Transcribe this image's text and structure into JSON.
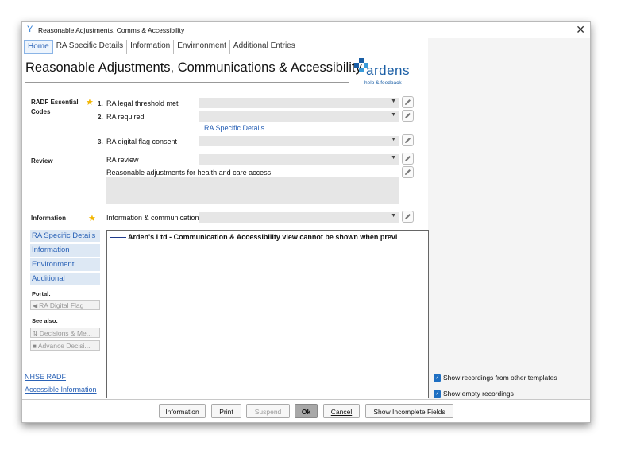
{
  "window": {
    "title": "Reasonable Adjustments, Comms & Accessibility",
    "close": "✕"
  },
  "tabs": [
    "Home",
    "RA Specific Details",
    "Information",
    "Envirnonment",
    "Additional Entries"
  ],
  "page_title": "Reasonable Adjustments, Communications & Accessibility",
  "logo": {
    "word": "ardens",
    "help": "help & feedback"
  },
  "sections": {
    "radf": {
      "label_line1": "RADF Essential",
      "label_line2": "Codes",
      "items": [
        {
          "num": "1.",
          "label": "RA legal threshold met"
        },
        {
          "num": "2.",
          "label": "RA required"
        },
        {
          "num": "3.",
          "label": "RA digital flag consent"
        }
      ],
      "link": "RA Specific Details"
    },
    "review": {
      "label": "Review",
      "field": "RA review",
      "text": "Reasonable adjustments for health and care access"
    },
    "information": {
      "label": "Information",
      "field": "Information & communication"
    }
  },
  "nav": [
    "RA Specific Details",
    "Information",
    "Environment",
    "Additional"
  ],
  "portal": {
    "label": "Portal:",
    "button": "RA Digital Flag"
  },
  "see_also": {
    "label": "See also:",
    "buttons": [
      "Decisions & Me...",
      "Advance Decisi..."
    ]
  },
  "viewer_message": "Arden's Ltd - Communication & Accessibility view cannot be shown when previ",
  "links": [
    "NHSE RADF",
    "Accessible Information"
  ],
  "options": {
    "show_other_templates": "Show recordings from other templates",
    "show_empty": "Show empty recordings"
  },
  "buttons": {
    "information": "Information",
    "print": "Print",
    "suspend": "Suspend",
    "ok": "Ok",
    "cancel": "Cancel",
    "show_incomplete": "Show Incomplete Fields"
  },
  "colors": {
    "accent": "#2a62b6",
    "star": "#f2b500",
    "checkbox": "#1e6fc2",
    "logo": "#1a5ea5"
  },
  "icons": [
    "template-icon",
    "close-icon",
    "star-icon",
    "pencil-icon",
    "dropdown-arrow-icon",
    "flag-icon",
    "decisions-icon",
    "document-icon"
  ]
}
